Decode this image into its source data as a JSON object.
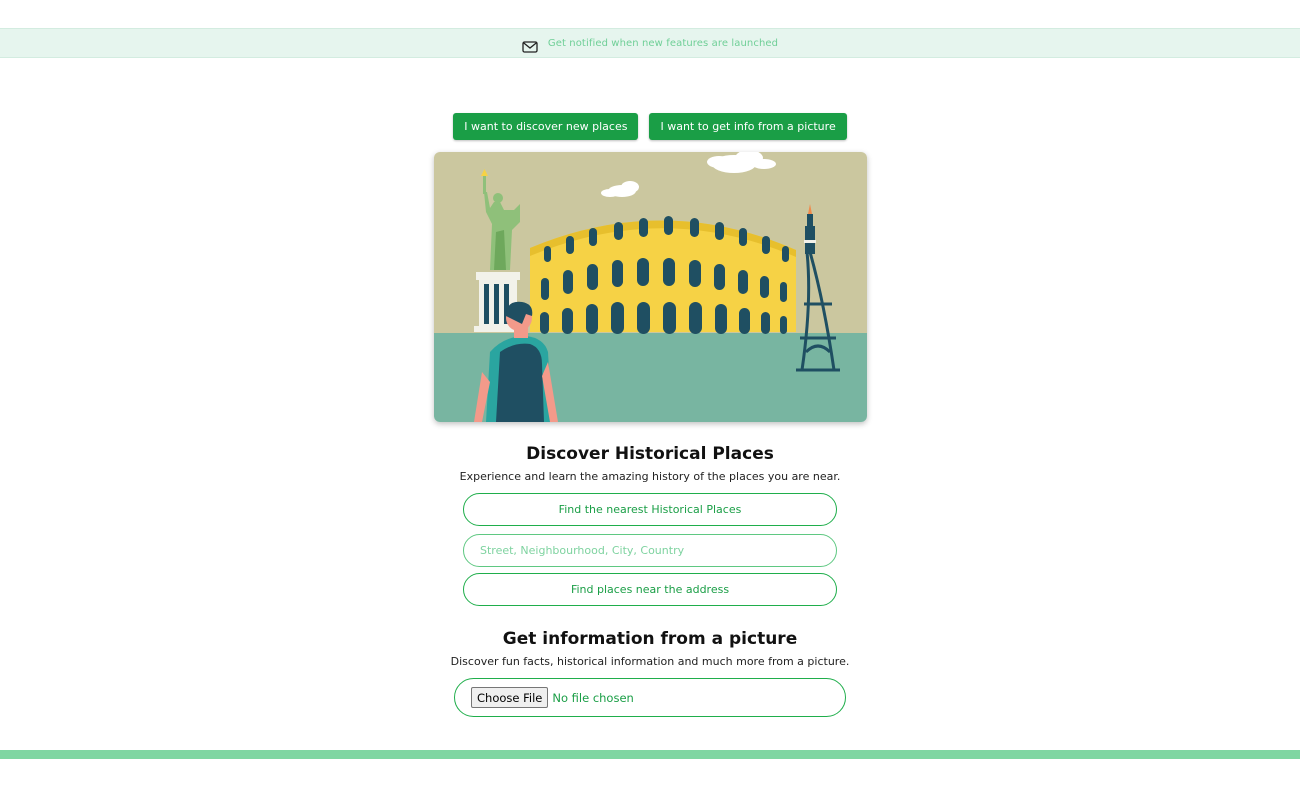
{
  "notification": {
    "icon": "mail-icon",
    "text": "Get notified when new features are launched"
  },
  "modes": {
    "discover_label": "I want to discover new places",
    "picture_label": "I want to get info from a picture"
  },
  "hero": {
    "illustration": "landmarks-illustration",
    "colors": {
      "sky": "#cbc79f",
      "ground": "#78b5a1",
      "colosseum": "#f6d245",
      "arches": "#1f4f62"
    }
  },
  "discover": {
    "title": "Discover Historical Places",
    "subtitle": "Experience and learn the amazing history of the places you are near.",
    "nearest_button": "Find the nearest Historical Places",
    "address_placeholder": "Street, Neighbourhood, City, Country",
    "address_value": "",
    "address_button": "Find places near the address"
  },
  "picture": {
    "title": "Get information from a picture",
    "subtitle": "Discover fun facts, historical information and much more from a picture.",
    "choose_file_label": "Choose File",
    "file_status": "No file chosen"
  },
  "theme": {
    "accent": "#1a9e46",
    "accent_light": "#7fd6a2",
    "notify_bg": "#e6f5ee"
  }
}
